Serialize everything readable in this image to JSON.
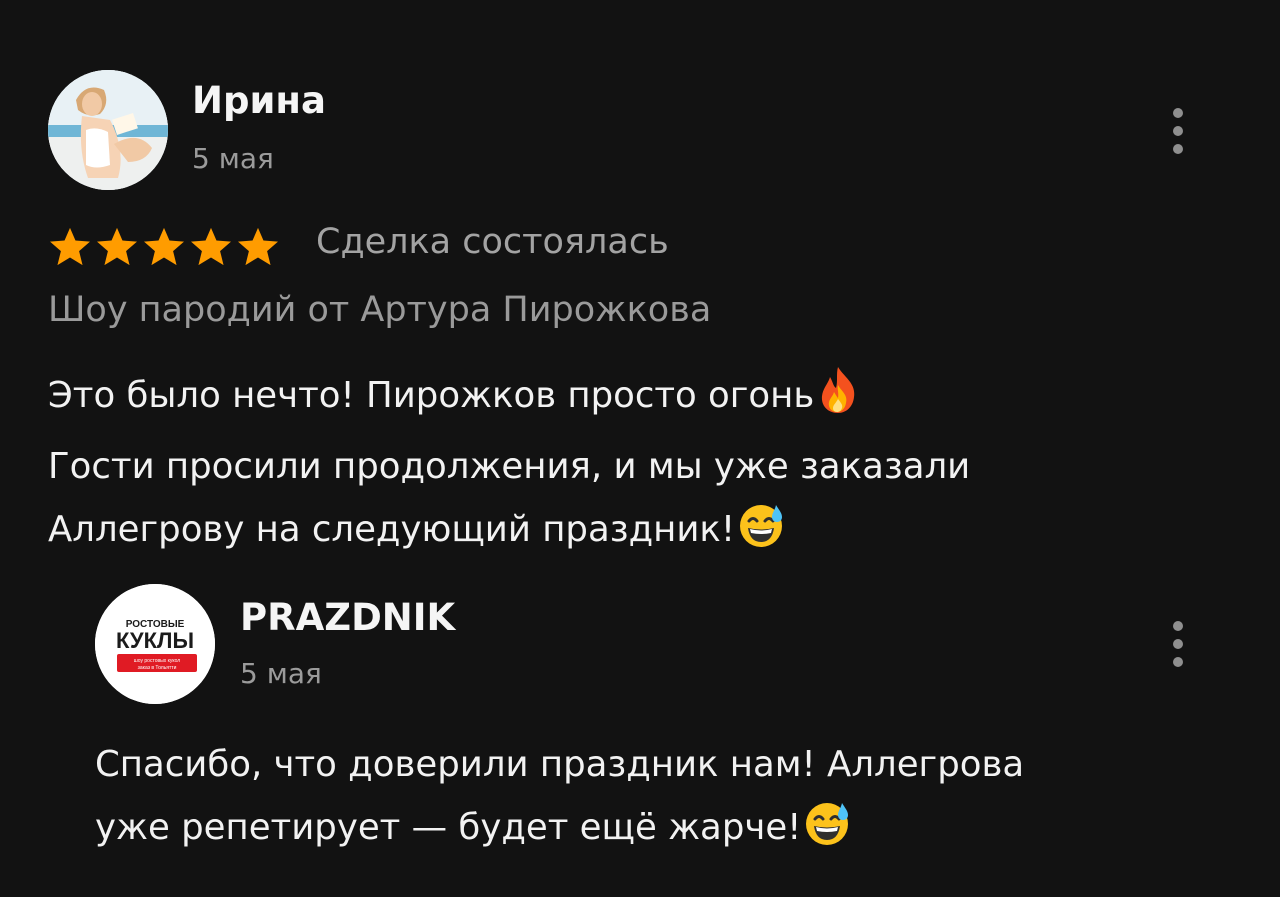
{
  "review": {
    "author": "Ирина",
    "date": "5 мая",
    "rating": 5,
    "rating_max": 5,
    "deal_status": "Сделка состоялась",
    "service": "Шоу пародий от Артура Пирожкова",
    "text_lines": [
      "Это было нечто! Пирожков просто огонь",
      "Гости просили продолжения, и мы уже заказали",
      "Аллегрову на следующий праздник!"
    ],
    "line_emojis": [
      "fire-emoji",
      "",
      "grinning-sweat-emoji"
    ],
    "colors": {
      "star": "#FF9C00",
      "background": "#121212"
    }
  },
  "reply": {
    "author": "PRAZDNIK",
    "date": "5 мая",
    "avatar_logo": {
      "line1": "РОСТОВЫЕ",
      "line2": "КУКЛЫ",
      "line3": "шоу ростовых кукол",
      "line4": "заказ в Тольятти"
    },
    "text_lines": [
      "Спасибо, что доверили праздник нам! Аллегрова",
      "уже репетирует — будет ещё жарче!"
    ],
    "line_emojis": [
      "",
      "grinning-sweat-emoji"
    ]
  }
}
